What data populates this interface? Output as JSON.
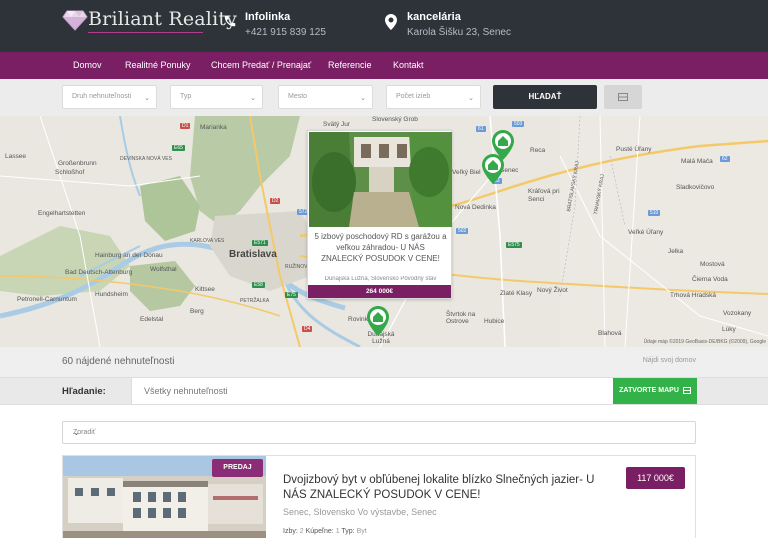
{
  "header": {
    "logo_text": "Briliant Reality",
    "phone": {
      "label": "Infolinka",
      "value": "+421 915 839 125"
    },
    "office": {
      "label": "kancelária",
      "value": "Karola Šišku 23, Senec"
    }
  },
  "nav": {
    "items": [
      "Domov",
      "Realitné Ponuky",
      "Chcem Predať / Prenajať",
      "Referencie",
      "Kontakt"
    ]
  },
  "filters": {
    "type": "Druh nehnuteľnosti",
    "kind": "Typ",
    "city": "Mesto",
    "rooms": "Počet izieb",
    "search_button": "HĽADAŤ",
    "view_toggle_icon": "grid-icon"
  },
  "map": {
    "places": {
      "bratislava": "Bratislava",
      "marianka": "Marianka",
      "lasee": "Lassee",
      "grossenbrunn": "Großenbrunn",
      "schlosshof": "Schloßhof",
      "devinska": "DEVÍNSKA NOVÁ VES",
      "engelhartstetten": "Engelhartstetten",
      "hainburg": "Hainburg an der Donau",
      "bad": "Bad Deutsch-Altenburg",
      "wolfsthal": "Wolfsthal",
      "hundsheim": "Hundsheim",
      "petronell": "Petronell-Carnuntum",
      "edelstal": "Edelstal",
      "berg": "Berg",
      "kittsee": "Kittsee",
      "petrzalka": "PETRŽALKA",
      "karlova": "KARLOVA VES",
      "ruzinov": "RUŽINOV",
      "svaty": "Svätý Jur",
      "slovensky_grob": "Slovenský Grob",
      "velky_biel": "Veľký Biel",
      "senec": "Senec",
      "reca": "Reca",
      "pusteulany": "Pusté Úľany",
      "malamaca": "Malá Mača",
      "sladkovicovo": "Sladkovičovo",
      "kralova": "Kráľová pri Senci",
      "nova_dedinka": "Nová Dedinka",
      "velke_ulany": "Veľké Úľany",
      "jelka": "Jelka",
      "zlate_klasy": "Zlaté Klasy",
      "novy_zivot": "Nový Život",
      "ciernavoda": "Čierna Voda",
      "mostova": "Mostová",
      "vozokany": "Vozokany",
      "trhova": "Trhová Hradská",
      "blahova": "Blahová",
      "hubice": "Hubice",
      "stvrtok": "Štvrtok na Ostrove",
      "rovinka": "Rovinka",
      "dunajska_luzna": "Dunajská Lužná",
      "luky": "Lúky",
      "bratislavsky_kraj": "BRATISLAVSKÝ KRAJ",
      "trnavsky_kraj": "TRNAVSKÝ KRAJ"
    },
    "roads": [
      "E65",
      "E58",
      "E571",
      "E575",
      "D1",
      "D2",
      "D4",
      "61",
      "62",
      "63",
      "502",
      "503",
      "510",
      "572",
      "E75"
    ],
    "attribution": "Údaje máp ©2019 GeoBasis-DE/BKG (©2009), Google",
    "popup": {
      "title": "5 izbový poschodový RD s garážou a veľkou záhradou- U NÁS ZNALECKÝ POSUDOK V CENE!",
      "location": "Dunajská Lužná, Slovensko Pôvodný stav",
      "price": "264 000€",
      "close": "×"
    }
  },
  "results": {
    "count": "60 nájdené nehnuteľnosti",
    "find_link": "Nájdi svoj domov"
  },
  "search": {
    "label": "Hľadanie:",
    "value": "Všetky nehnuteľnosti",
    "close_map": "ZATVORTE MAPU"
  },
  "sort": {
    "placeholder": "Zoradiť"
  },
  "listings": [
    {
      "badge": "PREDAJ",
      "title": "Dvojizbový byt v obľúbenej lokalite blízko Slnečných jazier- U NÁS ZNALECKÝ POSUDOK V CENE!",
      "location": "Senec, Slovensko Vo výstavbe, Senec",
      "price": "117 000€",
      "attrs": {
        "rooms_label": "Izby:",
        "rooms": "2",
        "bath_label": "Kúpeľne:",
        "bath": "1",
        "type_label": "Typ:",
        "type": "Byt"
      }
    }
  ],
  "colors": {
    "header": "#2d3339",
    "brand": "#7a1f63",
    "accent_green": "#34b24a"
  }
}
